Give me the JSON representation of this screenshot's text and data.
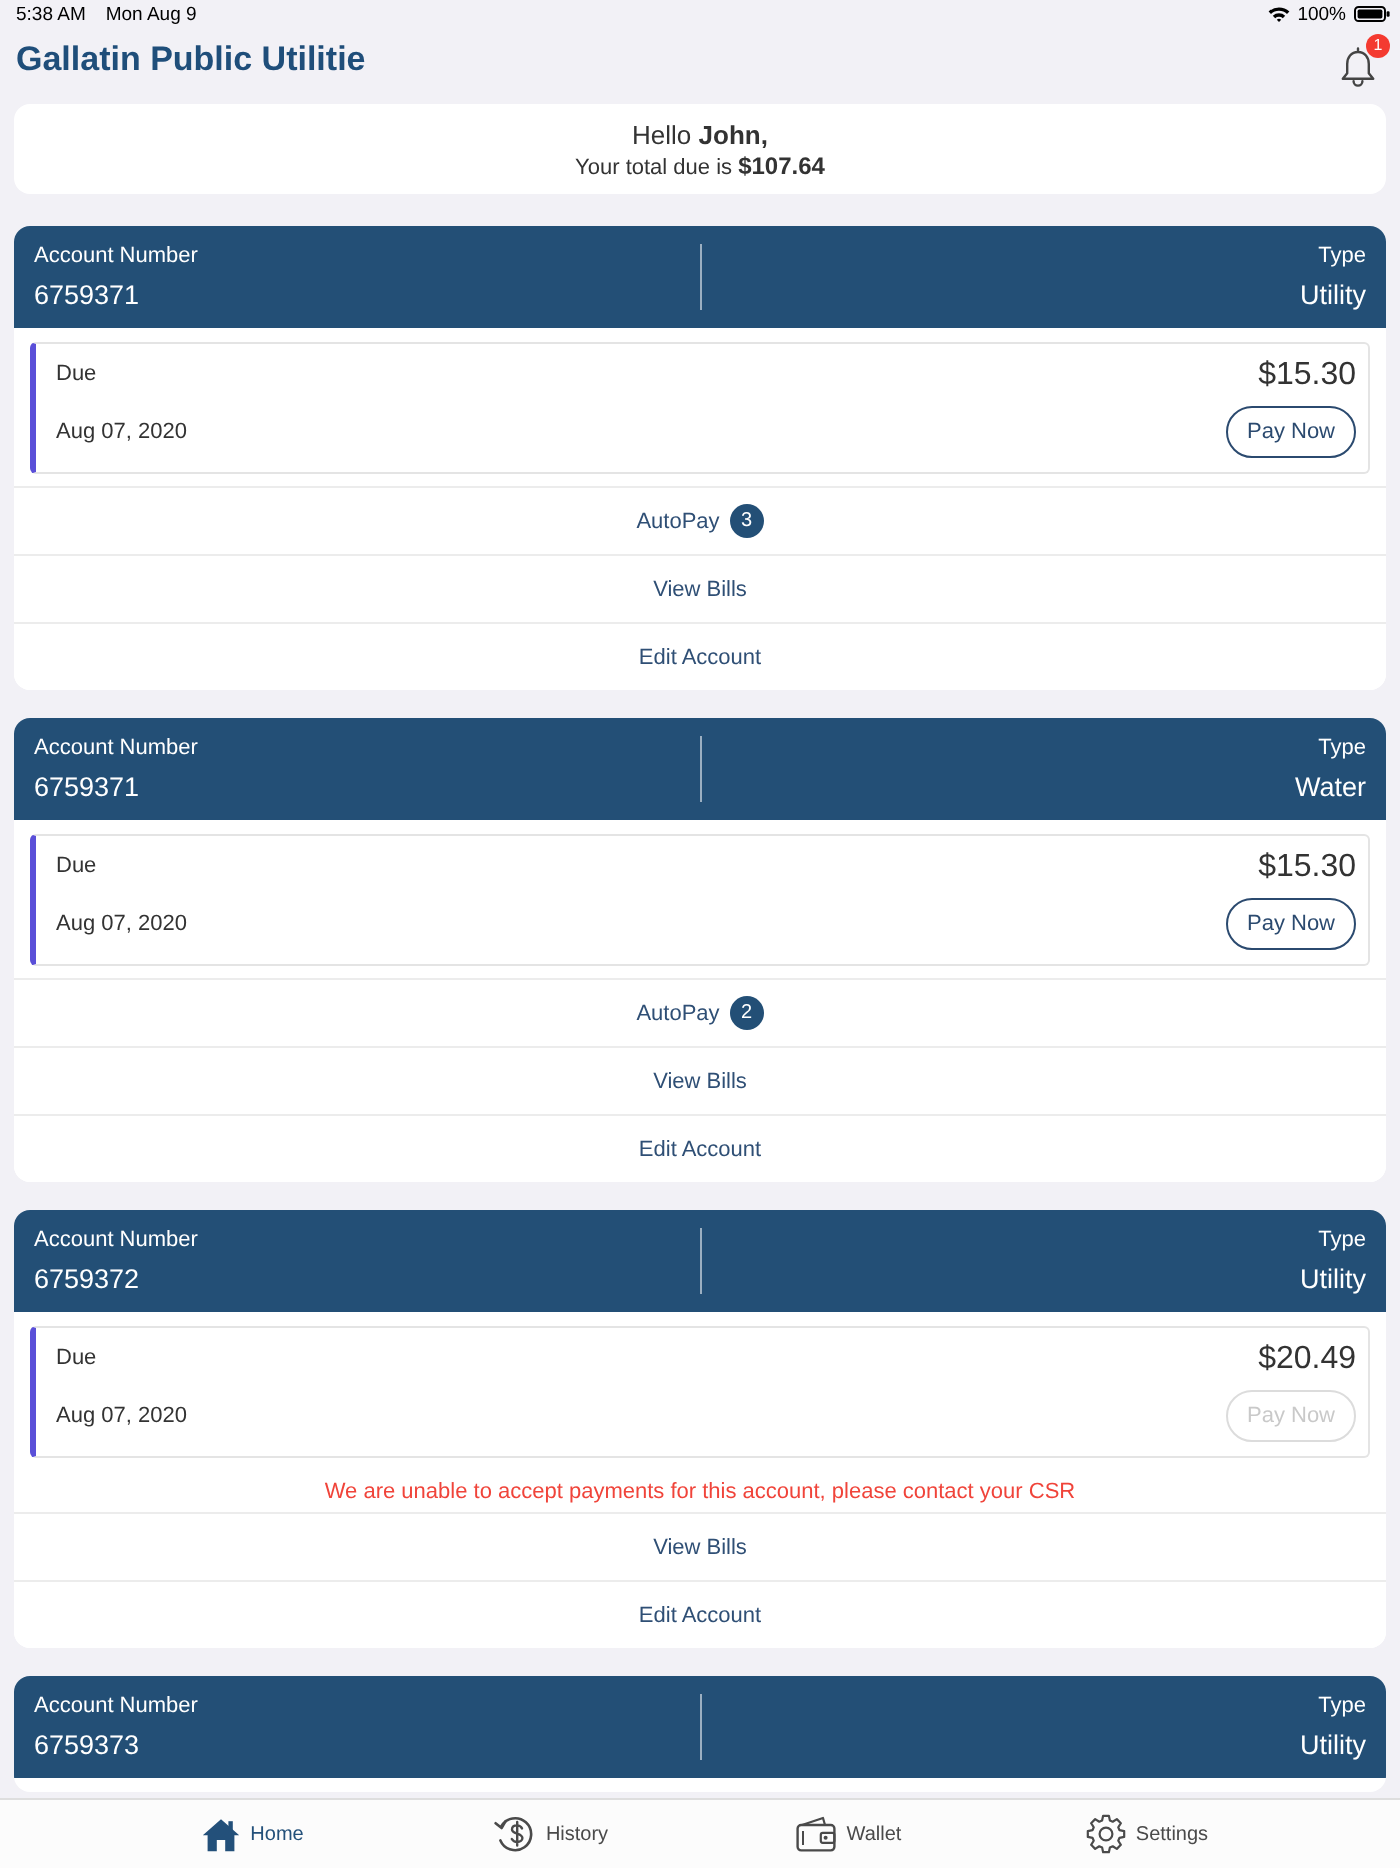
{
  "status_bar": {
    "time": "5:38 AM",
    "date": "Mon Aug 9",
    "battery": "100%"
  },
  "header": {
    "title": "Gallatin Public Utilitie",
    "notifications": "1"
  },
  "greeting": {
    "hello": "Hello **John,**",
    "total": "Your total due is **$107.64**"
  },
  "accounts": [
    {
      "number_label": "Account Number",
      "number": "6759371",
      "type_label": "Type",
      "type": "Utility",
      "bill": {
        "label": "Due",
        "amount": "$15.30",
        "date": "Aug 07, 2020",
        "pay_button": "Pay Now",
        "disabled": false
      },
      "actions": [
        {
          "kind": "autopay",
          "label": "AutoPay",
          "count": "3"
        },
        {
          "kind": "view_bills",
          "label": "View Bills"
        },
        {
          "kind": "edit_account",
          "label": "Edit Account"
        }
      ]
    },
    {
      "number_label": "Account Number",
      "number": "6759371",
      "type_label": "Type",
      "type": "Water",
      "bill": {
        "label": "Due",
        "amount": "$15.30",
        "date": "Aug 07, 2020",
        "pay_button": "Pay Now",
        "disabled": false
      },
      "actions": [
        {
          "kind": "autopay",
          "label": "AutoPay",
          "count": "2"
        },
        {
          "kind": "view_bills",
          "label": "View Bills"
        },
        {
          "kind": "edit_account",
          "label": "Edit Account"
        }
      ]
    },
    {
      "number_label": "Account Number",
      "number": "6759372",
      "type_label": "Type",
      "type": "Utility",
      "bill": {
        "label": "Due",
        "amount": "$20.49",
        "date": "Aug 07, 2020",
        "pay_button": "Pay Now",
        "disabled": true
      },
      "error": "We are unable to accept payments for this account, please contact your CSR",
      "actions": [
        {
          "kind": "view_bills",
          "label": "View Bills"
        },
        {
          "kind": "edit_account",
          "label": "Edit Account"
        }
      ]
    },
    {
      "number_label": "Account Number",
      "number": "6759373",
      "type_label": "Type",
      "type": "Utility"
    }
  ],
  "tab_bar": [
    {
      "kind": "home",
      "label": "Home",
      "selected": true
    },
    {
      "kind": "history",
      "label": "History",
      "selected": false
    },
    {
      "kind": "wallet",
      "label": "Wallet",
      "selected": false
    },
    {
      "kind": "settings",
      "label": "Settings",
      "selected": false
    }
  ]
}
